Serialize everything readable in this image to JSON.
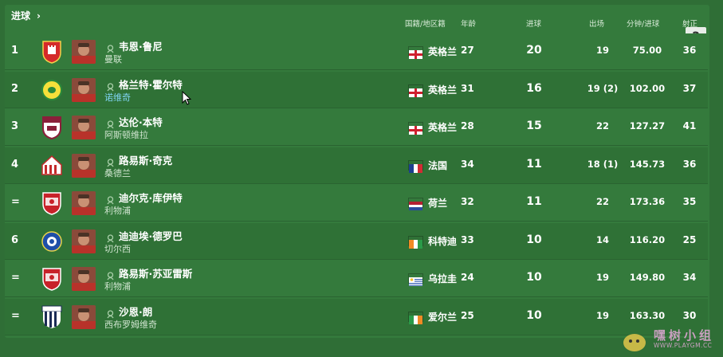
{
  "header": {
    "title": "进球",
    "columns": {
      "nation": "国籍/地区籍",
      "age": "年龄",
      "goals": "进球",
      "apps": "出场",
      "mpg": "分钟/进球",
      "shots": "射正"
    },
    "help": "?"
  },
  "colors": {
    "background": "#2f6e36",
    "row_dark": "#2f7136",
    "row_light": "#347a3c",
    "link": "#7fd3f0"
  },
  "rows": [
    {
      "rank": "1",
      "player": "韦恩·鲁尼",
      "club": "曼联",
      "nation": "英格兰",
      "age": "27",
      "goals": "20",
      "apps": "19",
      "mpg": "75.00",
      "shots": "36",
      "flag": "england",
      "crest": "red-shield-icon"
    },
    {
      "rank": "2",
      "player": "格兰特·霍尔特",
      "club": "诺维奇",
      "nation": "英格兰",
      "age": "31",
      "goals": "16",
      "apps": "19 (2)",
      "mpg": "102.00",
      "shots": "37",
      "flag": "england",
      "crest": "yellow-canary-icon"
    },
    {
      "rank": "3",
      "player": "达伦·本特",
      "club": "阿斯顿维拉",
      "nation": "英格兰",
      "age": "28",
      "goals": "15",
      "apps": "22",
      "mpg": "127.27",
      "shots": "41",
      "flag": "england",
      "crest": "maroon-shield-icon"
    },
    {
      "rank": "4",
      "player": "路易斯·奇克",
      "club": "桑德兰",
      "nation": "法国",
      "age": "34",
      "goals": "11",
      "apps": "18 (1)",
      "mpg": "145.73",
      "shots": "36",
      "flag": "france",
      "crest": "red-white-ship-icon"
    },
    {
      "rank": "=",
      "player": "迪尔克·库伊特",
      "club": "利物浦",
      "nation": "荷兰",
      "age": "32",
      "goals": "11",
      "apps": "22",
      "mpg": "173.36",
      "shots": "35",
      "flag": "netherlands",
      "crest": "red-liverbird-shield-icon"
    },
    {
      "rank": "6",
      "player": "迪迪埃·德罗巴",
      "club": "切尔西",
      "nation": "科特迪",
      "age": "33",
      "goals": "10",
      "apps": "14",
      "mpg": "116.20",
      "shots": "25",
      "flag": "ivory-coast",
      "crest": "blue-round-badge-icon"
    },
    {
      "rank": "=",
      "player": "路易斯·苏亚雷斯",
      "club": "利物浦",
      "nation": "乌拉圭",
      "age": "24",
      "goals": "10",
      "apps": "19",
      "mpg": "149.80",
      "shots": "34",
      "flag": "uruguay",
      "crest": "red-liverbird-shield-icon"
    },
    {
      "rank": "=",
      "player": "沙恩·朗",
      "club": "西布罗姆维奇",
      "nation": "爱尔兰",
      "age": "25",
      "goals": "10",
      "apps": "19",
      "mpg": "163.30",
      "shots": "30",
      "flag": "ireland",
      "crest": "albion-striped-shield-icon"
    }
  ],
  "watermark": {
    "text": "嘿树小组",
    "url": "WWW.PLAYGM.CC"
  }
}
